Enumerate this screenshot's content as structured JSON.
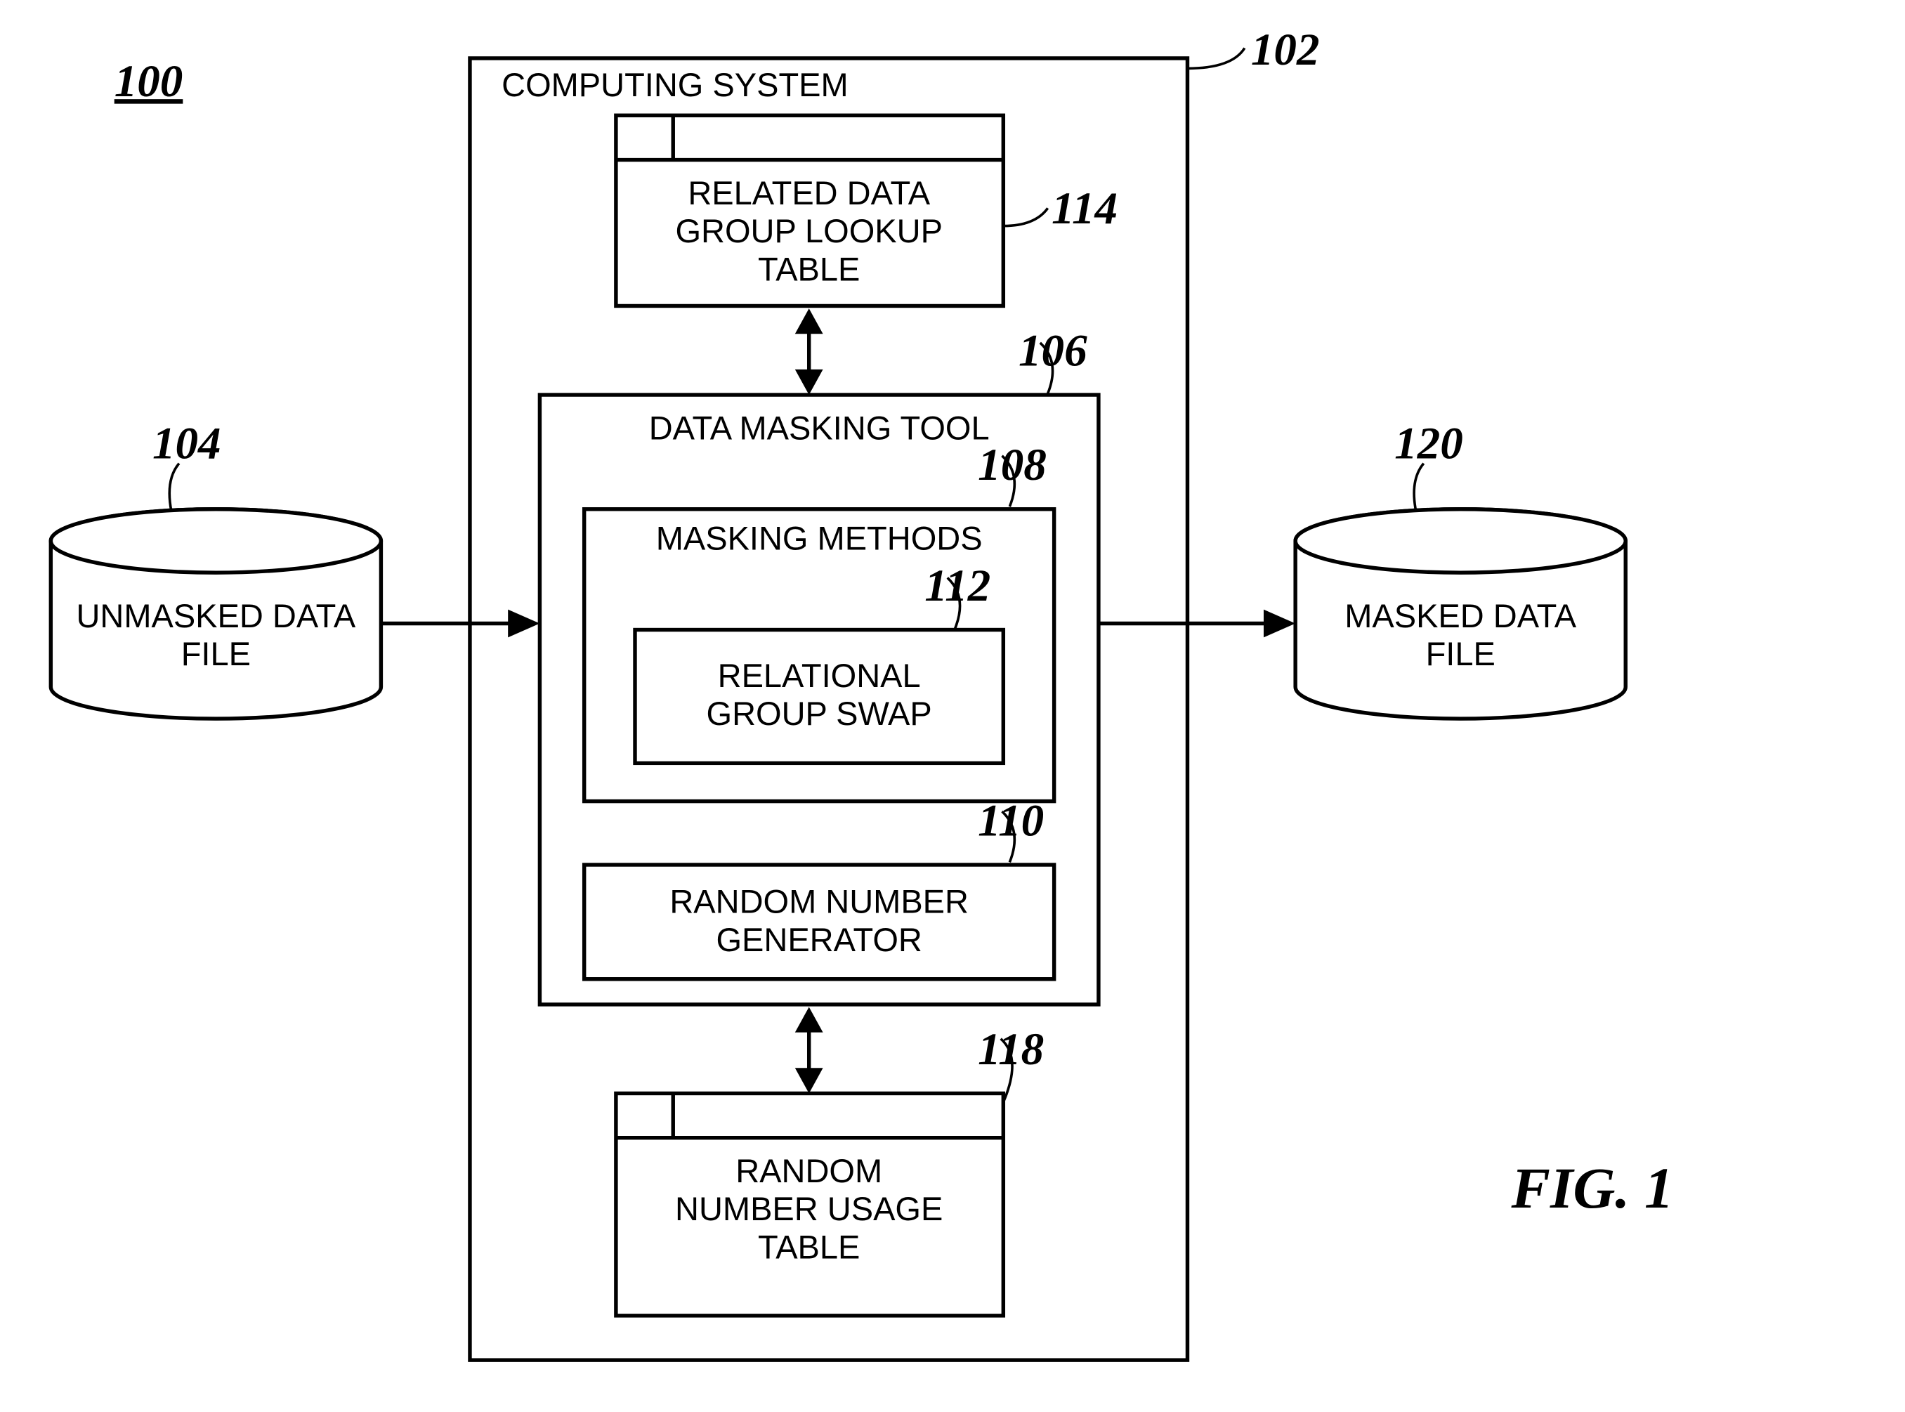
{
  "refs": {
    "overall": "100",
    "computingSystem": "102",
    "unmasked": "104",
    "dataMaskingTool": "106",
    "maskingMethods": "108",
    "randomNumGen": "110",
    "relationalGroupSwap": "112",
    "lookupTable": "114",
    "usageTable": "118",
    "masked": "120"
  },
  "labels": {
    "computingSystem": "COMPUTING SYSTEM",
    "lookup1": "RELATED DATA",
    "lookup2": "GROUP LOOKUP",
    "lookup3": "TABLE",
    "dataMaskingTool": "DATA MASKING TOOL",
    "maskingMethods": "MASKING METHODS",
    "relational1": "RELATIONAL",
    "relational2": "GROUP SWAP",
    "random1": "RANDOM NUMBER",
    "random2": "GENERATOR",
    "usage1": "RANDOM",
    "usage2": "NUMBER USAGE",
    "usage3": "TABLE",
    "unmasked1": "UNMASKED DATA",
    "unmasked2": "FILE",
    "masked1": "MASKED DATA",
    "masked2": "FILE",
    "fig": "FIG.  1"
  }
}
